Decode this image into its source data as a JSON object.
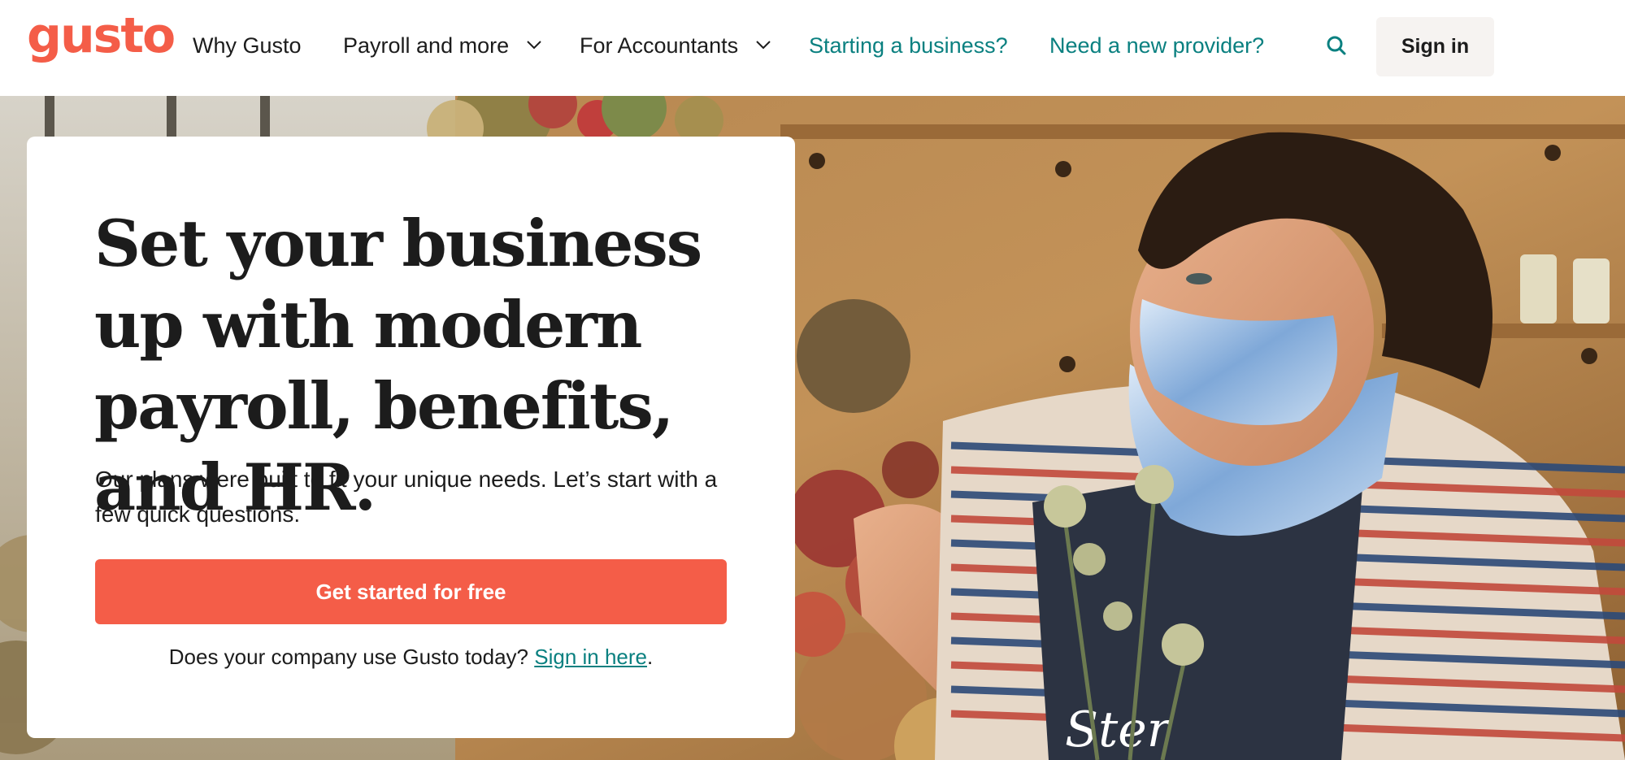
{
  "brand": {
    "logo_text": "gusto",
    "accent_color": "#f45d48",
    "link_color": "#0a8080"
  },
  "nav": {
    "items": [
      {
        "label": "Why Gusto",
        "has_dropdown": false
      },
      {
        "label": "Payroll and more",
        "has_dropdown": true
      },
      {
        "label": "For Accountants",
        "has_dropdown": true
      },
      {
        "label": "Starting a business?",
        "has_dropdown": false
      },
      {
        "label": "Need a new provider?",
        "has_dropdown": false
      }
    ],
    "search_icon": "search-icon",
    "sign_in_label": "Sign in"
  },
  "hero": {
    "headline": "Set your business up with modern payroll, benefits, and HR.",
    "subtext": "Our plans were built to fit your unique needs. Let’s start with a few quick questions.",
    "cta_label": "Get started for free",
    "signin_prompt": "Does your company use Gusto today? ",
    "signin_link": "Sign in here",
    "signin_suffix": "."
  }
}
